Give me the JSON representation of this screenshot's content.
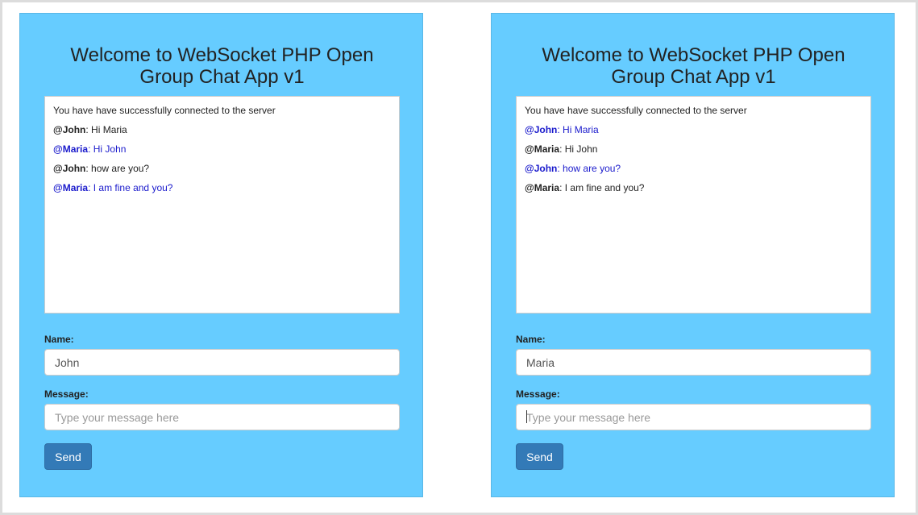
{
  "panels": [
    {
      "title": "Welcome to WebSocket PHP Open Group Chat App v1",
      "status": "You have have successfully connected to the server",
      "messages": [
        {
          "nick": "@John",
          "text": ": Hi Maria",
          "mine": false
        },
        {
          "nick": "@Maria",
          "text": ": Hi John",
          "mine": true
        },
        {
          "nick": "@John",
          "text": ": how are you?",
          "mine": false
        },
        {
          "nick": "@Maria",
          "text": ": I am fine and you?",
          "mine": true
        }
      ],
      "name_label": "Name:",
      "name_value": "John",
      "message_label": "Message:",
      "message_placeholder": "Type your message here",
      "send_label": "Send"
    },
    {
      "title": "Welcome to WebSocket PHP Open Group Chat App v1",
      "status": "You have have successfully connected to the server",
      "messages": [
        {
          "nick": "@John",
          "text": ": Hi Maria",
          "mine": true
        },
        {
          "nick": "@Maria",
          "text": ": Hi John",
          "mine": false
        },
        {
          "nick": "@John",
          "text": ": how are you?",
          "mine": true
        },
        {
          "nick": "@Maria",
          "text": ": I am fine and you?",
          "mine": false
        }
      ],
      "name_label": "Name:",
      "name_value": "Maria",
      "message_label": "Message:",
      "message_placeholder": "Type your message here",
      "send_label": "Send"
    }
  ],
  "colors": {
    "panel_background": "#66ccff",
    "own_message": "#1a1acc",
    "send_button": "#337ab7"
  }
}
